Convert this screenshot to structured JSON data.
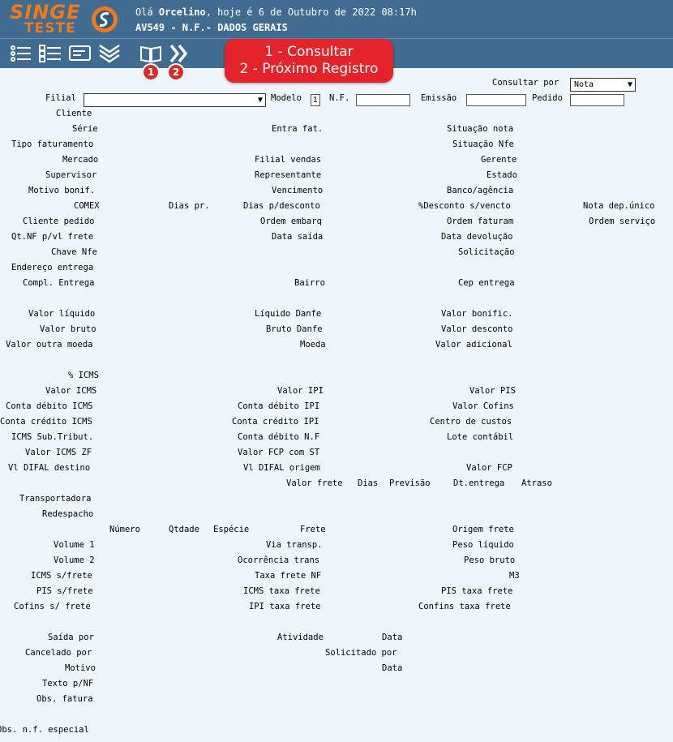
{
  "header": {
    "logo_top": "SINGE",
    "logo_bottom": "TESTE",
    "greeting_prefix": "Olá ",
    "user": "Orcelino",
    "greeting_suffix": ", hoje é 6 de Outubro de 2022 08:17h",
    "screen_title": "AV549 - N.F.- DADOS GERAIS"
  },
  "toolbar": {
    "icons": [
      "list-icon",
      "checklist-icon",
      "card-icon",
      "collapse-icon",
      "book-icon",
      "next-icon"
    ],
    "badge1": "1",
    "badge2": "2",
    "callout_line1": "1 - Consultar",
    "callout_line2": "2 - Próximo Registro"
  },
  "filters": {
    "consultar_por_label": "Consultar por",
    "consultar_por_value": "Nota",
    "filial_label": "Filial",
    "modelo_label": "Modelo",
    "modelo_value": "1",
    "nf_label": "N.F.",
    "emissao_label": "Emissão",
    "pedido_label": "Pedido",
    "cliente_label": "Cliente"
  },
  "labels": {
    "serie": "Série",
    "entra_fat": "Entra fat.",
    "situacao_nota": "Situação nota",
    "tipo_faturamento": "Tipo faturamento",
    "situacao_nfe": "Situação Nfe",
    "mercado": "Mercado",
    "filial_vendas": "Filial vendas",
    "gerente": "Gerente",
    "supervisor": "Supervisor",
    "representante": "Representante",
    "estado": "Estado",
    "motivo_bonif": "Motivo bonif.",
    "vencimento": "Vencimento",
    "banco_agencia": "Banco/agência",
    "comex": "COMEX",
    "dias_pr": "Dias pr.",
    "dias_desconto": "Dias p/desconto",
    "desconto_vencto": "%Desconto s/vencto",
    "nota_dep_unico": "Nota dep.único",
    "cliente_pedido": "Cliente pedido",
    "ordem_embarq": "Ordem embarq",
    "ordem_faturam": "Ordem faturam",
    "ordem_servico": "Ordem serviço",
    "qt_nf": "Qt.NF p/vl frete",
    "data_saida": "Data saída",
    "data_devolucao": "Data devolução",
    "chave_nfe": "Chave Nfe",
    "solicitacao": "Solicitação",
    "endereco_entrega": "Endereço entrega",
    "compl_entrega": "Compl. Entrega",
    "bairro": "Bairro",
    "cep_entrega": "Cep entrega",
    "valor_liquido": "Valor líquido",
    "liquido_danfe": "Líquido Danfe",
    "valor_bonific": "Valor bonific.",
    "valor_bruto": "Valor bruto",
    "bruto_danfe": "Bruto Danfe",
    "valor_desconto": "Valor desconto",
    "valor_outra_moeda": "Valor outra moeda",
    "moeda": "Moeda",
    "valor_adicional": "Valor adicional",
    "pct_icms": "% ICMS",
    "valor_icms": "Valor ICMS",
    "valor_ipi": "Valor IPI",
    "valor_pis": "Valor PIS",
    "conta_debito_icms": "Conta débito ICMS",
    "conta_debito_ipi": "Conta débito IPI",
    "valor_cofins": "Valor Cofins",
    "conta_credito_icms": "Conta crédito ICMS",
    "conta_credito_ipi": "Conta crédito IPI",
    "centro_custos": "Centro de custos",
    "icms_sub_tribut": "ICMS Sub.Tribut.",
    "conta_debito_nf": "Conta débito N.F",
    "lote_contabil": "Lote contábil",
    "valor_icms_zf": "Valor ICMS ZF",
    "valor_fcp_st": "Valor FCP com ST",
    "vl_difal_destino": "Vl DIFAL destino",
    "vl_difal_origem": "Vl DIFAL origem",
    "valor_fcp": "Valor FCP",
    "valor_frete": "Valor frete",
    "dias": "Dias",
    "previsao": "Previsão",
    "dt_entrega": "Dt.entrega",
    "atraso": "Atraso",
    "transportadora": "Transportadora",
    "redespacho": "Redespacho",
    "numero": "Número",
    "qtdade": "Qtdade",
    "especie": "Espécie",
    "frete": "Frete",
    "origem_frete": "Origem frete",
    "volume1": "Volume 1",
    "via_transp": "Via transp.",
    "peso_liquido": "Peso líquido",
    "volume2": "Volume 2",
    "ocorrencia_trans": "Ocorrência trans",
    "peso_bruto": "Peso bruto",
    "icms_frete": "ICMS s/frete",
    "taxa_frete_nf": "Taxa frete NF",
    "m3": "M3",
    "pis_frete": "PIS s/frete",
    "icms_taxa_frete": "ICMS taxa frete",
    "pis_taxa_frete": "PIS taxa frete",
    "cofins_frete": "Cofins s/ frete",
    "ipi_taxa_frete": "IPI taxa frete",
    "confins_taxa_frete": "Confins taxa frete",
    "saida_por": "Saída por",
    "atividade": "Atividade",
    "data1": "Data",
    "cancelado_por": "Cancelado por",
    "solicitado_por": "Solicitado por",
    "motivo": "Motivo",
    "data2": "Data",
    "texto_nf": "Texto p/NF",
    "obs_fatura": "Obs. fatura",
    "obs_nf_especial": "Obs. n.f. especial"
  }
}
